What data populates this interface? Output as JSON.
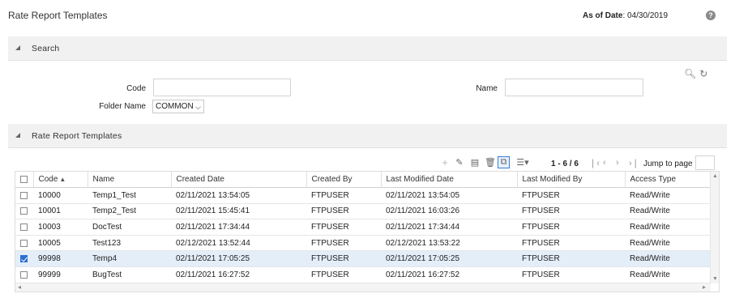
{
  "header": {
    "title": "Rate Report Templates",
    "as_of_label": "As of Date",
    "as_of_value": ": 04/30/2019",
    "help_glyph": "?"
  },
  "search_section": {
    "label": "Search",
    "code_label": "Code",
    "code_value": "",
    "name_label": "Name",
    "name_value": "",
    "folder_label": "Folder Name",
    "folder_value": "COMMON",
    "search_icon": "search-icon",
    "reset_icon": "refresh-icon"
  },
  "results_section": {
    "label": "Rate Report Templates"
  },
  "toolbar": {
    "icons": [
      "add-icon",
      "edit-icon",
      "view-icon",
      "delete-icon",
      "copy-icon",
      "column-view-icon"
    ],
    "pager_text": "1 - 6 / 6",
    "jump_label": "Jump to page",
    "jump_value": ""
  },
  "table": {
    "columns": [
      "Code",
      "Name",
      "Created Date",
      "Created By",
      "Last Modified Date",
      "Last Modified By",
      "Access Type"
    ],
    "sort_column": "Code",
    "sort_direction": "ascending",
    "rows": [
      {
        "checked": false,
        "code": "10000",
        "name": "Temp1_Test",
        "created_date": "02/11/2021 13:54:05",
        "created_by": "FTPUSER",
        "last_modified_date": "02/11/2021 13:54:05",
        "last_modified_by": "FTPUSER",
        "access_type": "Read/Write"
      },
      {
        "checked": false,
        "code": "10001",
        "name": "Temp2_Test",
        "created_date": "02/11/2021 15:45:41",
        "created_by": "FTPUSER",
        "last_modified_date": "02/11/2021 16:03:26",
        "last_modified_by": "FTPUSER",
        "access_type": "Read/Write"
      },
      {
        "checked": false,
        "code": "10003",
        "name": "DocTest",
        "created_date": "02/11/2021 17:34:44",
        "created_by": "FTPUSER",
        "last_modified_date": "02/11/2021 17:34:44",
        "last_modified_by": "FTPUSER",
        "access_type": "Read/Write"
      },
      {
        "checked": false,
        "code": "10005",
        "name": "Test123",
        "created_date": "02/12/2021 13:52:44",
        "created_by": "FTPUSER",
        "last_modified_date": "02/12/2021 13:53:22",
        "last_modified_by": "FTPUSER",
        "access_type": "Read/Write"
      },
      {
        "checked": true,
        "code": "99998",
        "name": "Temp4",
        "created_date": "02/11/2021 17:05:25",
        "created_by": "FTPUSER",
        "last_modified_date": "02/11/2021 17:05:25",
        "last_modified_by": "FTPUSER",
        "access_type": "Read/Write"
      },
      {
        "checked": false,
        "code": "99999",
        "name": "BugTest",
        "created_date": "02/11/2021 16:27:52",
        "created_by": "FTPUSER",
        "last_modified_date": "02/11/2021 16:27:52",
        "last_modified_by": "FTPUSER",
        "access_type": "Read/Write"
      }
    ]
  },
  "colors": {
    "selected_row": "#e4eef9",
    "checkbox_checked": "#2b6fd0",
    "section_bar": "#f1f1f1"
  }
}
